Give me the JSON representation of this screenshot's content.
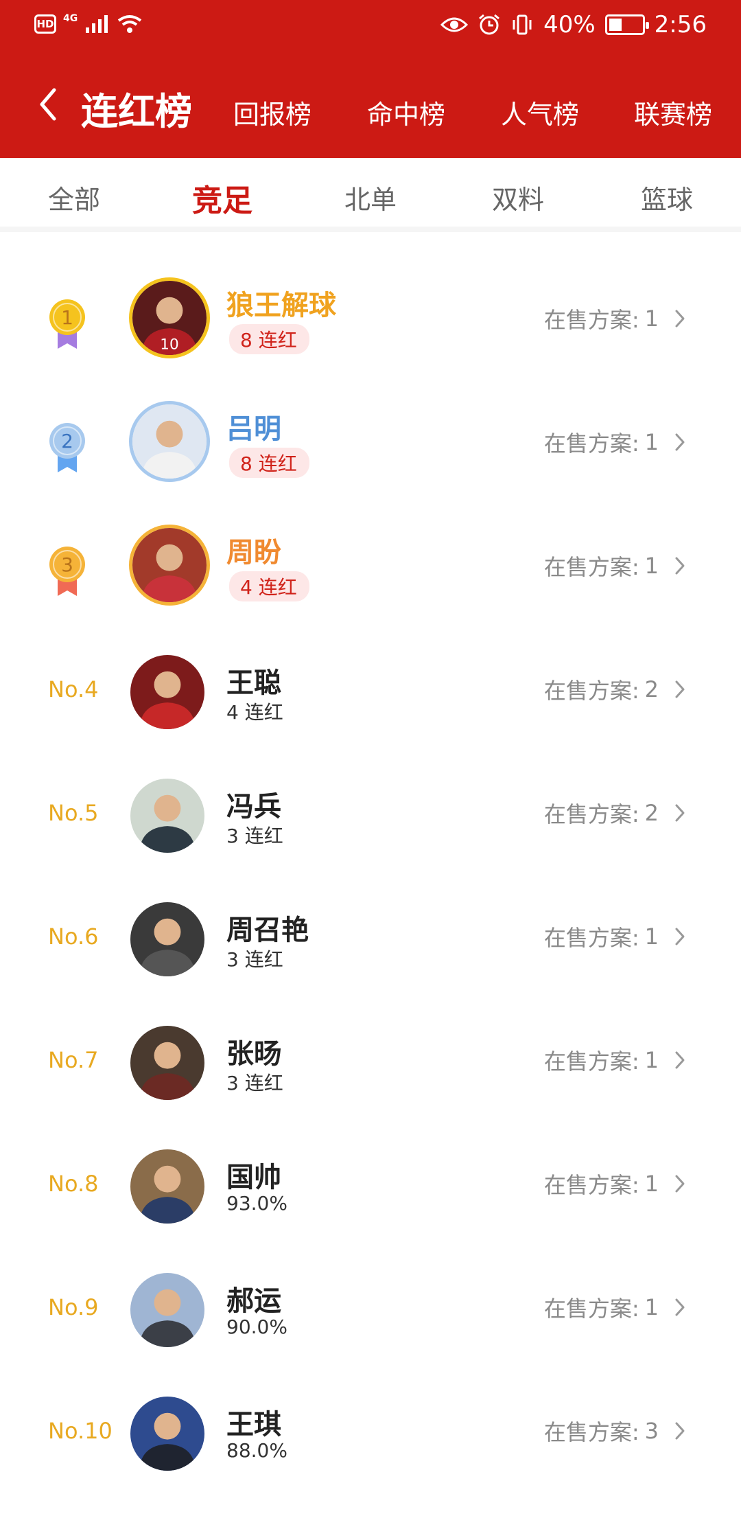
{
  "status_bar": {
    "hd": "HD",
    "network": "4G",
    "battery": "40%",
    "battery_level": 0.4,
    "time": "2:56"
  },
  "header": {
    "title": "连红榜",
    "tabs": [
      "回报榜",
      "命中榜",
      "人气榜",
      "联赛榜"
    ]
  },
  "subtabs": {
    "items": [
      "全部",
      "竞足",
      "北单",
      "双料",
      "篮球"
    ],
    "active": "竞足"
  },
  "sale_label": "在售方案:",
  "list": [
    {
      "rank": "1",
      "name": "狼王解球",
      "stat": "8 连红",
      "count": "1",
      "name_color": "#f0a21f",
      "medal_color": "#f5c31e",
      "ribbon_color": "#a57ce0",
      "avatar_jersey": "10"
    },
    {
      "rank": "2",
      "name": "吕明",
      "stat": "8 连红",
      "count": "1",
      "name_color": "#4f8fd6",
      "medal_color": "#a7c9ee",
      "ribbon_color": "#63a5f0"
    },
    {
      "rank": "3",
      "name": "周盼",
      "stat": "4 连红",
      "count": "1",
      "name_color": "#f08a30",
      "medal_color": "#f5b338",
      "ribbon_color": "#f06a55"
    },
    {
      "rank": "No.4",
      "name": "王聪",
      "stat": "4 连红",
      "count": "2"
    },
    {
      "rank": "No.5",
      "name": "冯兵",
      "stat": "3 连红",
      "count": "2"
    },
    {
      "rank": "No.6",
      "name": "周召艳",
      "stat": "3 连红",
      "count": "1"
    },
    {
      "rank": "No.7",
      "name": "张旸",
      "stat": "3 连红",
      "count": "1"
    },
    {
      "rank": "No.8",
      "name": "国帅",
      "stat": "93.0%",
      "count": "1"
    },
    {
      "rank": "No.9",
      "name": "郝运",
      "stat": "90.0%",
      "count": "1"
    },
    {
      "rank": "No.10",
      "name": "王琪",
      "stat": "88.0%",
      "count": "3"
    }
  ]
}
